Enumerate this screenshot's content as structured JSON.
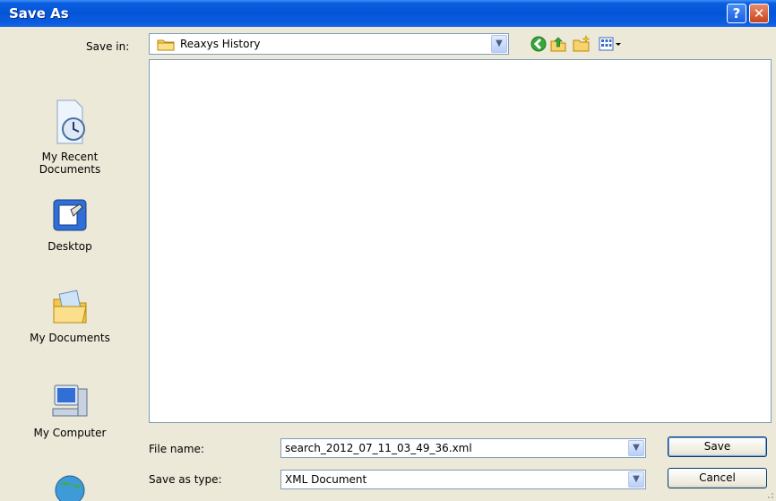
{
  "window": {
    "title": "Save As"
  },
  "titlebar": {
    "help_glyph": "?",
    "close_glyph": "✕"
  },
  "save_in": {
    "label": "Save in:",
    "value": "Reaxys History"
  },
  "toolbar": {
    "icons": [
      "back-icon",
      "up-folder-icon",
      "new-folder-icon",
      "views-menu-icon"
    ]
  },
  "places": [
    {
      "label_line1": "My Recent",
      "label_line2": "Documents"
    },
    {
      "label_line1": "Desktop"
    },
    {
      "label_line1": "My Documents"
    },
    {
      "label_line1": "My Computer"
    }
  ],
  "file_name": {
    "label": "File name:",
    "value": "search_2012_07_11_03_49_36.xml"
  },
  "save_as_type": {
    "label": "Save as type:",
    "value": "XML Document"
  },
  "buttons": {
    "save": "Save",
    "cancel": "Cancel"
  }
}
